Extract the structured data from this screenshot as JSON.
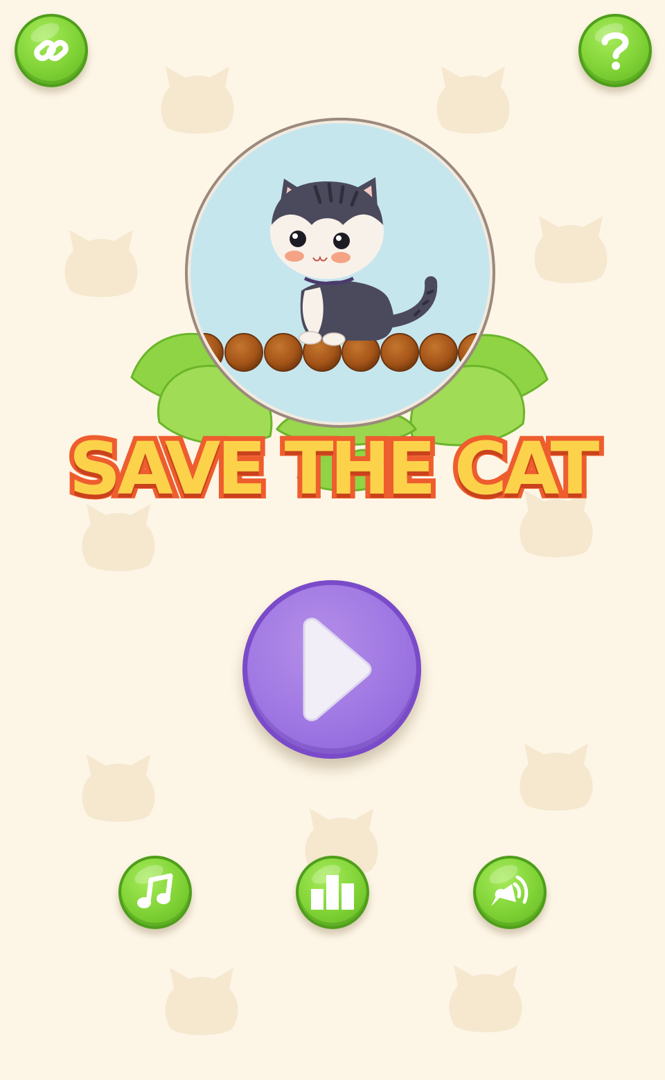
{
  "title": "SAVE THE CAT",
  "colors": {
    "background": "#fdf5e6",
    "green_button": "#7fd235",
    "play_button": "#9f77e3",
    "title_fill": "#fcd24a",
    "title_outline": "#ee5d2e"
  },
  "buttons": {
    "top_left": {
      "icon": "link-icon"
    },
    "top_right": {
      "icon": "question-icon"
    },
    "play": {
      "icon": "play-icon"
    },
    "bottom": [
      {
        "icon": "music-note-icon"
      },
      {
        "icon": "bar-chart-icon"
      },
      {
        "icon": "speaker-icon"
      }
    ]
  },
  "hero": {
    "icon": "cat-illustration",
    "ball_count": 8
  }
}
